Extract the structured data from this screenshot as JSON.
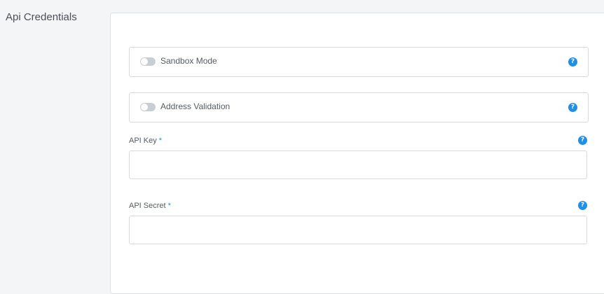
{
  "section": {
    "title": "Api Credentials"
  },
  "toggles": [
    {
      "label": "Sandbox Mode",
      "on": false,
      "help": "?"
    },
    {
      "label": "Address Validation",
      "on": false,
      "help": "?"
    }
  ],
  "fields": [
    {
      "label": "API Key",
      "required_mark": "*",
      "value": "",
      "placeholder": "",
      "help": "?"
    },
    {
      "label": "API Secret",
      "required_mark": "*",
      "value": "",
      "placeholder": "",
      "help": "?"
    }
  ],
  "colors": {
    "accent": "#1e90e6",
    "toggle_off": "#c9ced4",
    "panel_bg": "#ffffff",
    "page_bg": "#f4f5f7"
  }
}
